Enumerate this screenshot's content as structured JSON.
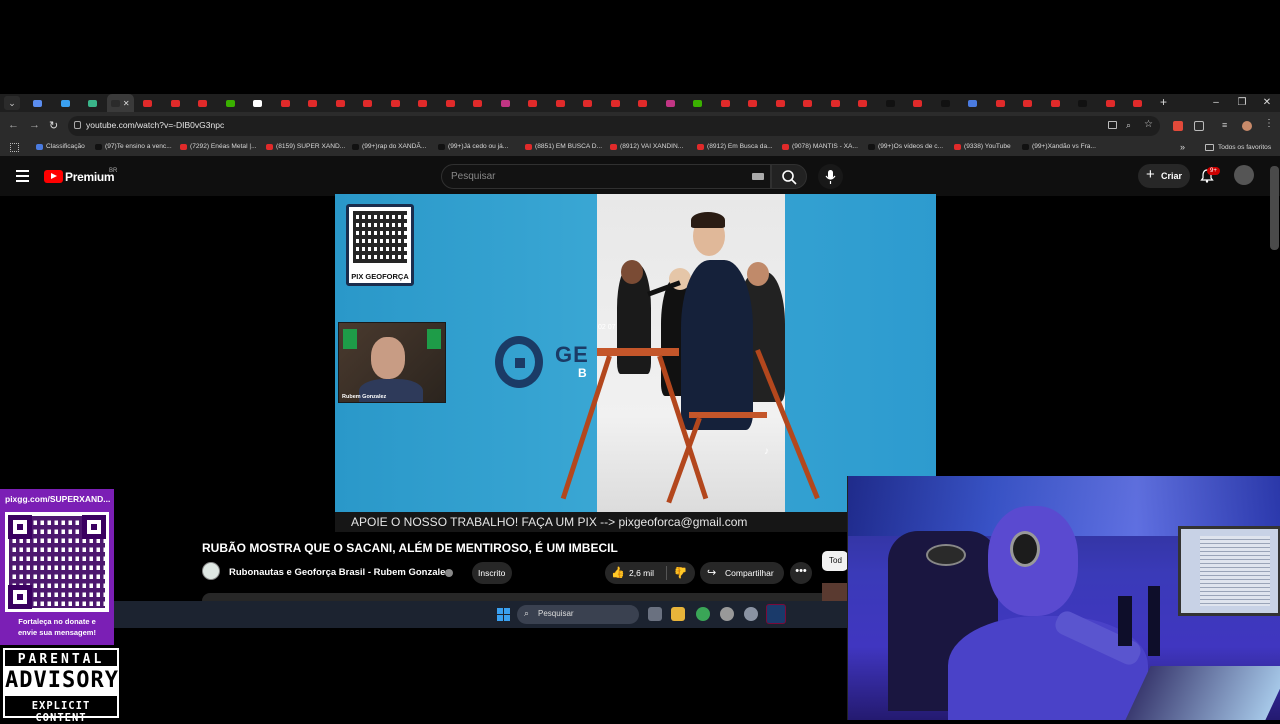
{
  "browser": {
    "tab_count": 41,
    "active_tab_index": 3,
    "tab_colors": [
      "#5b8def",
      "#3aa0f0",
      "#3ab58a",
      "#2b2b2b",
      "#e02a2a",
      "#e02a2a",
      "#e02a2a",
      "#3ab000",
      "#ffffff",
      "#e02a2a",
      "#e02a2a",
      "#e02a2a",
      "#e02a2a",
      "#e02a2a",
      "#e02a2a",
      "#e02a2a",
      "#e02a2a",
      "#c13584",
      "#e02a2a",
      "#e02a2a",
      "#e02a2a",
      "#e02a2a",
      "#e02a2a",
      "#c13584",
      "#3ab000",
      "#e02a2a",
      "#e02a2a",
      "#e02a2a",
      "#e02a2a",
      "#e02a2a",
      "#e02a2a",
      "#111111",
      "#e02a2a",
      "#111111",
      "#4a7be0",
      "#e02a2a",
      "#e02a2a",
      "#e02a2a",
      "#111111",
      "#e02a2a",
      "#e02a2a"
    ],
    "new_tab_label": "+",
    "minimize": "–",
    "maximize": "❐",
    "close": "✕",
    "url": "youtube.com/watch?v=-DIB0vG3npc",
    "back_icon": "←",
    "forward_icon": "→",
    "reload_icon": "↻",
    "bookmarks": [
      {
        "label": "Classificação",
        "color": "#4a7be0"
      },
      {
        "label": "(97)Te ensino a venc...",
        "color": "#111111"
      },
      {
        "label": "(7292) Enéas Metal |...",
        "color": "#e02a2a"
      },
      {
        "label": "(8159) SUPER XAND...",
        "color": "#e02a2a"
      },
      {
        "label": "(99+)rap do XANDÃ...",
        "color": "#111111"
      },
      {
        "label": "(99+)Já cedo ou já...",
        "color": "#111111"
      },
      {
        "label": "(8851) EM BUSCA D...",
        "color": "#e02a2a"
      },
      {
        "label": "(8912) VAI XANDIN...",
        "color": "#e02a2a"
      },
      {
        "label": "(8912) Em Busca da...",
        "color": "#e02a2a"
      },
      {
        "label": "(9078) MANTIS - XA...",
        "color": "#e02a2a"
      },
      {
        "label": "(99+)Os vídeos de c...",
        "color": "#111111"
      },
      {
        "label": "(9338) YouTube",
        "color": "#e02a2a"
      },
      {
        "label": "(99+)Xandão vs Fra...",
        "color": "#111111"
      }
    ],
    "more_bookmarks": "»",
    "all_bookmarks": "Todos os favoritos"
  },
  "youtube": {
    "brand": "Premium",
    "country": "BR",
    "search_placeholder": "Pesquisar",
    "create_label": "Criar",
    "notif_count": "9+",
    "video": {
      "qr_label": "PIX GEOFORÇA",
      "logo_text": "GE",
      "logo_sub": "B",
      "inset_label": "Rubem Gonzalez",
      "date_watermark": "02 07",
      "ticker": "APOIE O NOSSO TRABALHO! FAÇA UM PIX --> pixgeoforca@gmail.com"
    },
    "title": "RUBÃO MOSTRA QUE O SACANI, ALÉM DE MENTIROSO, É UM IMBECIL",
    "channel": "Rubonautas e Geoforça Brasil - Rubem Gonzalez",
    "subscribed_label": "Inscrito",
    "likes": "2,6 mil",
    "share_label": "Compartilhar",
    "more_label": "•••",
    "side_chip": "Tod"
  },
  "taskbar": {
    "search_label": "Pesquisar"
  },
  "overlay": {
    "pix_url": "pixgg.com/SUPERXAND...",
    "pix_msg1": "Fortaleça no donate e",
    "pix_msg2": "envie sua mensagem!",
    "advisory_1": "PARENTAL",
    "advisory_2": "ADVISORY",
    "advisory_3": "EXPLICIT CONTENT"
  }
}
